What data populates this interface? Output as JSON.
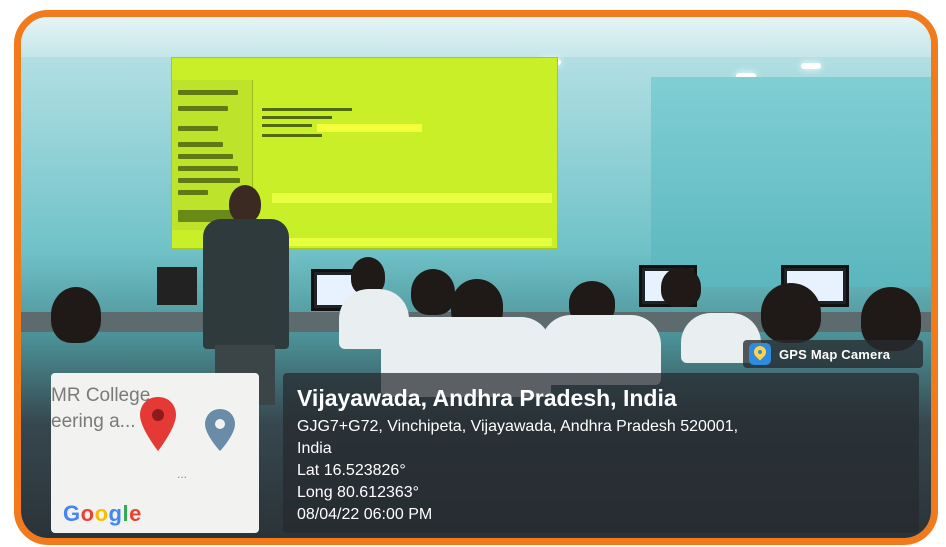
{
  "location": {
    "title": "Vijayawada, Andhra Pradesh, India",
    "address_line1": "GJG7+G72, Vinchipeta, Vijayawada, Andhra Pradesh 520001,",
    "address_line2": "India",
    "latitude": "Lat 16.523826°",
    "longitude": "Long 80.612363°",
    "datetime": "08/04/22 06:00 PM"
  },
  "badge": {
    "label": "GPS Map Camera",
    "icon": "gps-map-camera-icon"
  },
  "map": {
    "place_line1": "MR College",
    "place_line2": "eering a...",
    "more": "...",
    "brand": {
      "g1": "G",
      "g2": "o",
      "g3": "o",
      "g4": "g",
      "g5": "l",
      "g6": "e"
    }
  },
  "colors": {
    "frame": "#f07a1c",
    "projection": "#c8ef28",
    "pin_red": "#e53935",
    "pin_blue": "#6a8ca8"
  }
}
